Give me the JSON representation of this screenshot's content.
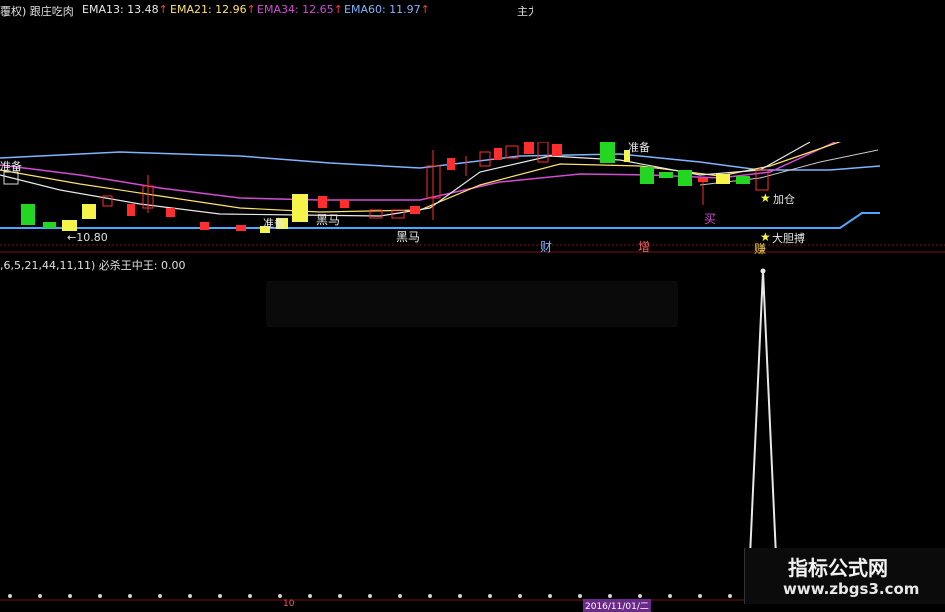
{
  "header": {
    "title": "覆权) 跟庄吃肉",
    "ema13": "EMA13: 13.48",
    "ema21": "EMA21: 12.96",
    "ema34": "EMA34: 12.65",
    "ema60": "EMA60: 11.97",
    "arrow": "↑",
    "right_label": "主力"
  },
  "colors": {
    "ema13": "#e8e8e8",
    "ema21": "#ffe26b",
    "ema34": "#d44cd4",
    "ema60": "#7fb4ff",
    "up": "#ff2e2e",
    "down": "#22d622",
    "yellow": "#f4f44a",
    "baseline": "#4aa8ff"
  },
  "main_chart": {
    "price_low_label": "←10.80",
    "signals": [
      "准备",
      "准备",
      "黑马",
      "黑马",
      "准备",
      "买",
      "加仓",
      "大胆搏"
    ],
    "band_labels": [
      "财",
      "增",
      "赚"
    ]
  },
  "indicator": {
    "params_label": ",6,5,21,44,11,11) 必杀王中王: 0.00"
  },
  "xaxis": {
    "tick_label": "10",
    "date_label": "2016/11/01/二"
  },
  "watermark": {
    "title": "指标公式网",
    "url": "www.zbgs3.com"
  }
}
